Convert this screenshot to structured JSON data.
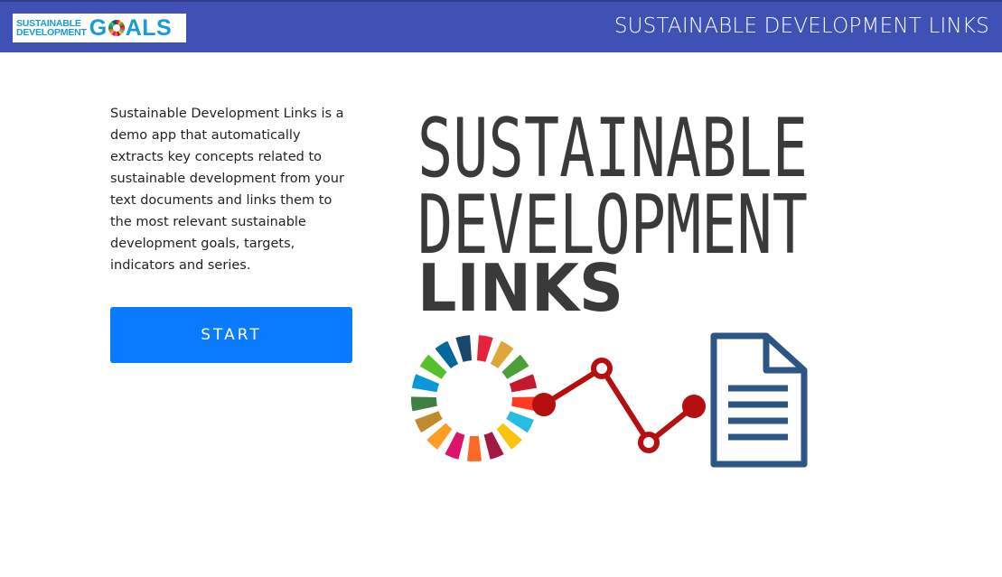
{
  "header": {
    "logo_text_line1": "SUSTAINABLE",
    "logo_text_line2": "DEVELOPMENT",
    "logo_goals_g": "G",
    "logo_goals_rest": "ALS",
    "title": "SUSTAINABLE DEVELOPMENT LINKS",
    "bar_color": "#3f51b5"
  },
  "main": {
    "description": "Sustainable Development Links is a demo app that automatically extracts key concepts related to sustainable development from your text documents and links them to the most relevant sustainable development goals, targets, indicators and series.",
    "start_button_label": "START",
    "button_color": "#0a7bff"
  },
  "brand": {
    "line1": "SUSTAINABLE",
    "line2": "DEVELOPMENT",
    "line3": "LINKS",
    "text_color": "#3a3a3a",
    "link_color": "#b50f10",
    "document_color": "#2c5585",
    "icons": [
      "sdg-wheel-icon",
      "link-chain-icon",
      "document-icon"
    ]
  }
}
